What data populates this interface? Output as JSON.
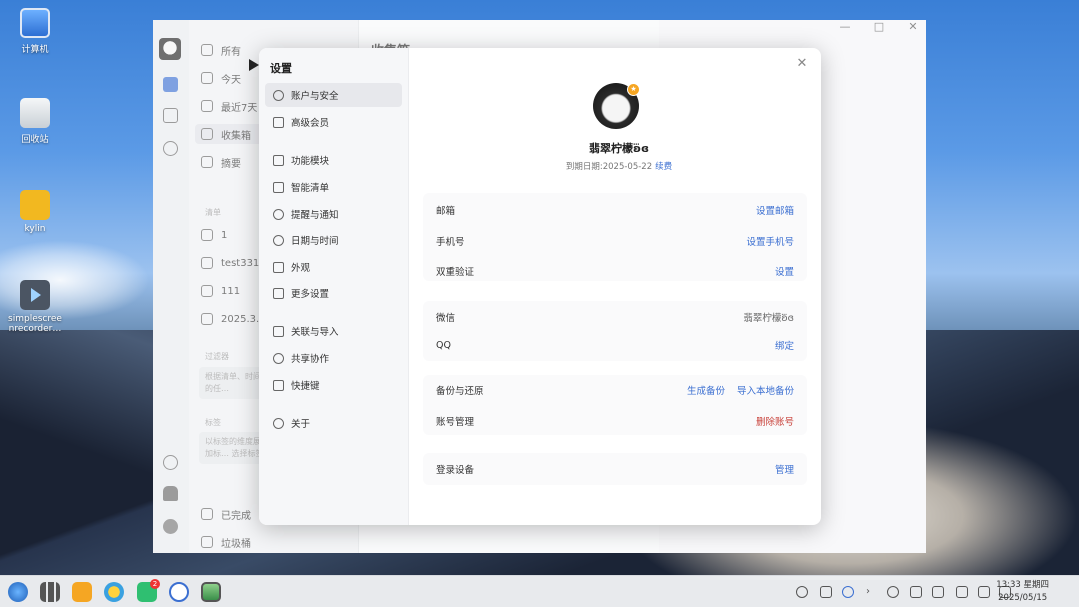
{
  "desktop": {
    "icons": [
      {
        "label": "计算机"
      },
      {
        "label": "回收站"
      },
      {
        "label": "kylin"
      },
      {
        "label": "simplescreenrecorder…",
        "line1": "simplescree",
        "line2": "nrecorder…"
      }
    ]
  },
  "app": {
    "nav": {
      "items": [
        "所有",
        "今天",
        "最近7天",
        "收集箱",
        "摘要"
      ],
      "list_section": "清单",
      "lists": [
        "1",
        "test331",
        "111",
        "2025.3.2"
      ],
      "filter_section": "过滤器",
      "filter_hint": "根据清单、时间… 过滤出特定的任…",
      "tags_section": "标签",
      "tags_hint": "以标签的维度展… 务。右击添加标… 选择标签",
      "bottom": [
        "已完成",
        "垃圾桶"
      ]
    },
    "list_title": "收集箱",
    "window_controls": {
      "minimize": "—",
      "maximize": "□",
      "close": "✕"
    }
  },
  "settings": {
    "title": "设置",
    "close_glyph": "✕",
    "menu": [
      {
        "label": "账户与安全",
        "icon": "user-circle-icon",
        "selected": true
      },
      {
        "label": "高级会员",
        "icon": "crown-icon"
      },
      {
        "label": "功能模块",
        "icon": "modules-icon"
      },
      {
        "label": "智能清单",
        "icon": "filter-icon"
      },
      {
        "label": "提醒与通知",
        "icon": "bell-icon"
      },
      {
        "label": "日期与时间",
        "icon": "clock-icon"
      },
      {
        "label": "外观",
        "icon": "appearance-icon"
      },
      {
        "label": "更多设置",
        "icon": "more-settings-icon"
      },
      {
        "label": "关联与导入",
        "icon": "import-icon"
      },
      {
        "label": "共享协作",
        "icon": "share-icon"
      },
      {
        "label": "快捷键",
        "icon": "keyboard-icon"
      },
      {
        "label": "关于",
        "icon": "info-icon"
      }
    ],
    "profile": {
      "username": "翡翠柠檬ʚ⃛ɞ",
      "expiry_label": "到期日期:2025-05-22",
      "renew_link": "续费",
      "badge_glyph": "★"
    },
    "rows": {
      "email": {
        "label": "邮箱",
        "action": "设置邮箱"
      },
      "phone": {
        "label": "手机号",
        "action": "设置手机号"
      },
      "twofa": {
        "label": "双重验证",
        "action": "设置"
      },
      "wechat": {
        "label": "微信",
        "value": "翡翠柠檬ʚ⃛ɞ"
      },
      "qq": {
        "label": "QQ",
        "action": "绑定"
      },
      "backup": {
        "label": "备份与还原",
        "action1": "生成备份",
        "action2": "导入本地备份"
      },
      "account": {
        "label": "账号管理",
        "action": "删除账号"
      },
      "devices": {
        "label": "登录设备",
        "action": "管理"
      }
    }
  },
  "taskbar": {
    "time": "13:33 星期四",
    "date": "2025/05/15",
    "badge_count": "2"
  },
  "colors": {
    "accent": "#3b6fd1",
    "danger": "#c8413a",
    "vip": "#f6a623"
  }
}
